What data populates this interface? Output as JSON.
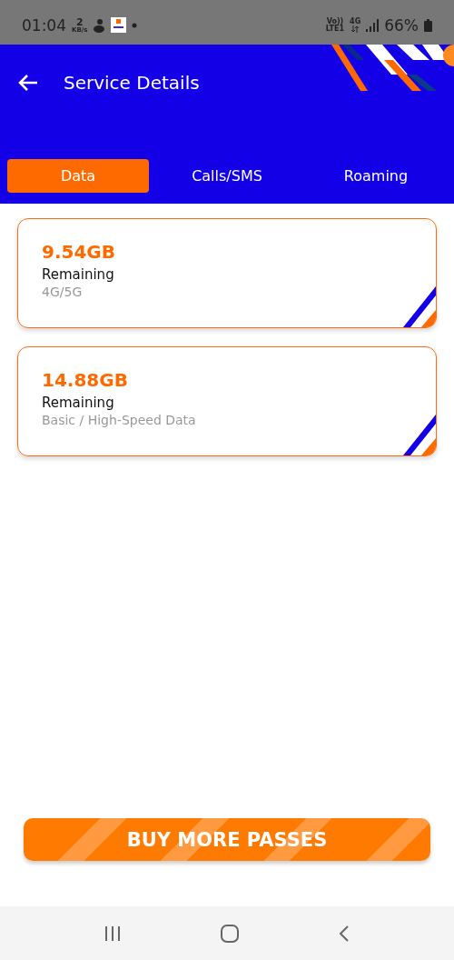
{
  "status_bar": {
    "time": "01:04",
    "speed_value": "2",
    "speed_unit": "KB/s",
    "volte": "Vo))",
    "lte": "LTE1",
    "network": "4G",
    "battery": "66%"
  },
  "header": {
    "title": "Service Details"
  },
  "tabs": [
    {
      "label": "Data",
      "selected": true
    },
    {
      "label": "Calls/SMS",
      "selected": false
    },
    {
      "label": "Roaming",
      "selected": false
    }
  ],
  "cards": [
    {
      "amount": "9.54GB",
      "label": "Remaining",
      "type": "4G/5G"
    },
    {
      "amount": "14.88GB",
      "label": "Remaining",
      "type": "Basic / High-Speed Data"
    }
  ],
  "button": {
    "label": "BUY MORE PASSES"
  }
}
